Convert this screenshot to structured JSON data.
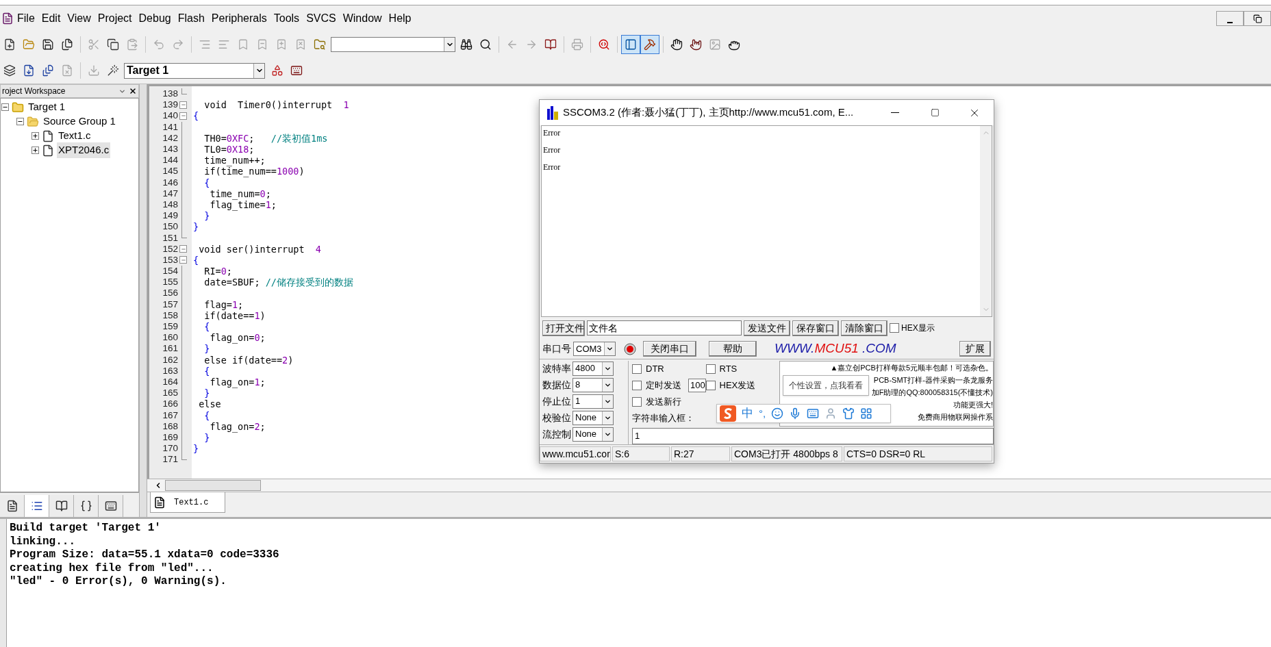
{
  "menu": [
    "File",
    "Edit",
    "View",
    "Project",
    "Debug",
    "Flash",
    "Peripherals",
    "Tools",
    "SVCS",
    "Window",
    "Help"
  ],
  "toolbar_main": [
    {
      "kind": "new",
      "disabled": false,
      "pressed": false
    },
    {
      "kind": "open",
      "disabled": false,
      "pressed": false
    },
    {
      "kind": "save",
      "disabled": false,
      "pressed": false
    },
    {
      "kind": "saveall",
      "disabled": false,
      "pressed": false
    },
    {
      "kind": "sep"
    },
    {
      "kind": "cut",
      "disabled": true,
      "pressed": false
    },
    {
      "kind": "copy",
      "disabled": false,
      "pressed": false
    },
    {
      "kind": "paste",
      "disabled": true,
      "pressed": false
    },
    {
      "kind": "sep"
    },
    {
      "kind": "undo",
      "disabled": true,
      "pressed": false
    },
    {
      "kind": "redo",
      "disabled": true,
      "pressed": false
    },
    {
      "kind": "sep"
    },
    {
      "kind": "indent",
      "disabled": true,
      "pressed": false
    },
    {
      "kind": "outdent",
      "disabled": true,
      "pressed": false
    },
    {
      "kind": "bookmark",
      "disabled": true,
      "pressed": false
    },
    {
      "kind": "bmprev",
      "disabled": true,
      "pressed": false
    },
    {
      "kind": "bmnext",
      "disabled": true,
      "pressed": false
    },
    {
      "kind": "bmclear",
      "disabled": true,
      "pressed": false
    },
    {
      "kind": "findfiles",
      "disabled": false,
      "pressed": false
    },
    {
      "kind": "combo"
    },
    {
      "kind": "find",
      "disabled": false,
      "pressed": false
    },
    {
      "kind": "incfind",
      "disabled": false,
      "pressed": false
    },
    {
      "kind": "sep"
    },
    {
      "kind": "back",
      "disabled": true,
      "pressed": false
    },
    {
      "kind": "forward",
      "disabled": true,
      "pressed": false
    },
    {
      "kind": "book",
      "disabled": false,
      "pressed": false
    },
    {
      "kind": "sep"
    },
    {
      "kind": "print",
      "disabled": true,
      "pressed": false
    },
    {
      "kind": "sep"
    },
    {
      "kind": "debug",
      "disabled": false,
      "pressed": false
    },
    {
      "kind": "sep"
    },
    {
      "kind": "workspace",
      "disabled": false,
      "pressed": true
    },
    {
      "kind": "output",
      "disabled": false,
      "pressed": true
    },
    {
      "kind": "sep"
    },
    {
      "kind": "hand",
      "disabled": false,
      "pressed": false
    },
    {
      "kind": "handoff",
      "disabled": false,
      "pressed": false
    },
    {
      "kind": "image",
      "disabled": true,
      "pressed": false
    },
    {
      "kind": "grab",
      "disabled": false,
      "pressed": false
    }
  ],
  "toolbar_build": [
    {
      "kind": "translate",
      "disabled": false
    },
    {
      "kind": "build",
      "disabled": false
    },
    {
      "kind": "rebuild",
      "disabled": false
    },
    {
      "kind": "stop",
      "disabled": true
    },
    {
      "kind": "sep"
    },
    {
      "kind": "load",
      "disabled": true
    },
    {
      "kind": "options",
      "disabled": false
    }
  ],
  "target_select": {
    "value": "Target 1"
  },
  "toolbar_build_extra": [
    {
      "kind": "components",
      "disabled": false
    },
    {
      "kind": "books",
      "disabled": false
    }
  ],
  "workspace": {
    "title": "roject Workspace",
    "tree": [
      {
        "label": "Target 1",
        "kind": "target",
        "expanded": true,
        "selected": false,
        "children": [
          {
            "label": "Source Group 1",
            "kind": "group",
            "expanded": true,
            "selected": false,
            "children": [
              {
                "label": "Text1.c",
                "kind": "file",
                "expanded": false,
                "selected": false
              },
              {
                "label": "XPT2046.c",
                "kind": "file",
                "expanded": false,
                "selected": true
              }
            ]
          }
        ]
      }
    ],
    "tabs": [
      {
        "kind": "files",
        "selected": false
      },
      {
        "kind": "regs",
        "selected": true
      },
      {
        "kind": "books",
        "selected": false
      },
      {
        "kind": "functions",
        "selected": false
      },
      {
        "kind": "templates",
        "selected": false
      }
    ]
  },
  "editor": {
    "lines": [
      {
        "n": "138",
        "kind": "end"
      },
      {
        "n": "139",
        "kind": "minus",
        "parts": [
          {
            "kind": "plain",
            "text": "  void  Timer0()interrupt  "
          },
          {
            "kind": "number",
            "text": "1"
          }
        ]
      },
      {
        "n": "140",
        "kind": "minus",
        "parts": [
          {
            "kind": "brace",
            "text": "{"
          }
        ]
      },
      {
        "n": "141",
        "kind": "line"
      },
      {
        "n": "142",
        "kind": "line",
        "parts": [
          {
            "kind": "plain",
            "text": "  TH0="
          },
          {
            "kind": "number",
            "text": "0XFC"
          },
          {
            "kind": "plain",
            "text": ";   "
          },
          {
            "kind": "comment",
            "text": "//装初值1ms"
          }
        ]
      },
      {
        "n": "143",
        "kind": "line",
        "parts": [
          {
            "kind": "plain",
            "text": "  TL0="
          },
          {
            "kind": "number",
            "text": "0X18"
          },
          {
            "kind": "plain",
            "text": ";"
          }
        ]
      },
      {
        "n": "144",
        "kind": "line",
        "parts": [
          {
            "kind": "plain",
            "text": "  time_num++;"
          }
        ]
      },
      {
        "n": "145",
        "kind": "line",
        "parts": [
          {
            "kind": "plain",
            "text": "  if(time_num=="
          },
          {
            "kind": "number",
            "text": "1000"
          },
          {
            "kind": "plain",
            "text": ")"
          }
        ]
      },
      {
        "n": "146",
        "kind": "line",
        "parts": [
          {
            "kind": "brace",
            "text": "  {"
          }
        ]
      },
      {
        "n": "147",
        "kind": "line",
        "parts": [
          {
            "kind": "plain",
            "text": "   time_num="
          },
          {
            "kind": "number",
            "text": "0"
          },
          {
            "kind": "plain",
            "text": ";"
          }
        ]
      },
      {
        "n": "148",
        "kind": "line",
        "parts": [
          {
            "kind": "plain",
            "text": "   flag_time="
          },
          {
            "kind": "number",
            "text": "1"
          },
          {
            "kind": "plain",
            "text": ";"
          }
        ]
      },
      {
        "n": "149",
        "kind": "line",
        "parts": [
          {
            "kind": "brace",
            "text": "  }"
          }
        ]
      },
      {
        "n": "150",
        "kind": "line",
        "parts": [
          {
            "kind": "brace",
            "text": "}"
          }
        ]
      },
      {
        "n": "151",
        "kind": "end"
      },
      {
        "n": "152",
        "kind": "minus",
        "parts": [
          {
            "kind": "plain",
            "text": " void ser()interrupt  "
          },
          {
            "kind": "number",
            "text": "4"
          }
        ]
      },
      {
        "n": "153",
        "kind": "minus",
        "parts": [
          {
            "kind": "brace",
            "text": "{"
          }
        ]
      },
      {
        "n": "154",
        "kind": "line",
        "parts": [
          {
            "kind": "plain",
            "text": "  RI="
          },
          {
            "kind": "number",
            "text": "0"
          },
          {
            "kind": "plain",
            "text": ";"
          }
        ]
      },
      {
        "n": "155",
        "kind": "line",
        "parts": [
          {
            "kind": "plain",
            "text": "  date=SBUF; "
          },
          {
            "kind": "comment",
            "text": "//储存接受到的数据"
          }
        ]
      },
      {
        "n": "156",
        "kind": "line"
      },
      {
        "n": "157",
        "kind": "line",
        "parts": [
          {
            "kind": "plain",
            "text": "  flag="
          },
          {
            "kind": "number",
            "text": "1"
          },
          {
            "kind": "plain",
            "text": ";"
          }
        ]
      },
      {
        "n": "158",
        "kind": "line",
        "parts": [
          {
            "kind": "plain",
            "text": "  if(date=="
          },
          {
            "kind": "number",
            "text": "1"
          },
          {
            "kind": "plain",
            "text": ")"
          }
        ]
      },
      {
        "n": "159",
        "kind": "line",
        "parts": [
          {
            "kind": "brace",
            "text": "  {"
          }
        ]
      },
      {
        "n": "160",
        "kind": "line",
        "parts": [
          {
            "kind": "plain",
            "text": "   flag_on="
          },
          {
            "kind": "number",
            "text": "0"
          },
          {
            "kind": "plain",
            "text": ";"
          }
        ]
      },
      {
        "n": "161",
        "kind": "line",
        "parts": [
          {
            "kind": "brace",
            "text": "  }"
          }
        ]
      },
      {
        "n": "162",
        "kind": "line",
        "parts": [
          {
            "kind": "plain",
            "text": "  else if(date=="
          },
          {
            "kind": "number",
            "text": "2"
          },
          {
            "kind": "plain",
            "text": ")"
          }
        ]
      },
      {
        "n": "163",
        "kind": "line",
        "parts": [
          {
            "kind": "brace",
            "text": "  {"
          }
        ]
      },
      {
        "n": "164",
        "kind": "line",
        "parts": [
          {
            "kind": "plain",
            "text": "   flag_on="
          },
          {
            "kind": "number",
            "text": "1"
          },
          {
            "kind": "plain",
            "text": ";"
          }
        ]
      },
      {
        "n": "165",
        "kind": "line",
        "parts": [
          {
            "kind": "brace",
            "text": "  }"
          }
        ]
      },
      {
        "n": "166",
        "kind": "line",
        "parts": [
          {
            "kind": "plain",
            "text": " else"
          }
        ]
      },
      {
        "n": "167",
        "kind": "line",
        "parts": [
          {
            "kind": "brace",
            "text": "  {"
          }
        ]
      },
      {
        "n": "168",
        "kind": "line",
        "parts": [
          {
            "kind": "plain",
            "text": "   flag_on="
          },
          {
            "kind": "number",
            "text": "2"
          },
          {
            "kind": "plain",
            "text": ";"
          }
        ]
      },
      {
        "n": "169",
        "kind": "line",
        "parts": [
          {
            "kind": "brace",
            "text": "  }"
          }
        ]
      },
      {
        "n": "170",
        "kind": "line",
        "parts": [
          {
            "kind": "brace",
            "text": "}"
          }
        ]
      },
      {
        "n": "171",
        "kind": "end"
      }
    ],
    "tabs": [
      {
        "label": "Text1.c",
        "selected": true
      }
    ]
  },
  "output": [
    "Build target 'Target 1'",
    "linking...",
    "Program Size: data=55.1 xdata=0 code=3336",
    "creating hex file from \"led\"...",
    "\"led\" - 0 Error(s), 0 Warning(s)."
  ],
  "sscom": {
    "title": "SSCOM3.2 (作者:聂小猛(丁丁), 主页http://www.mcu51.com,  E...",
    "received": [
      "Error",
      "Error",
      "Error"
    ],
    "open_file_button": "打开文件",
    "file_name": "文件名",
    "send_file_button": "发送文件",
    "save_button": "保存窗口",
    "clear_button": "清除窗口",
    "hex_display": {
      "label": "HEX显示",
      "checked": false
    },
    "port_label": "串口号",
    "port": "COM3",
    "port_open": true,
    "close_port_button": "关闭串口",
    "help_button": "帮助",
    "logo": [
      {
        "text": "WWW.",
        "color": "#1c1ca8"
      },
      {
        "text": "MCU51",
        "color": "#e01010"
      },
      {
        "text": " .COM",
        "color": "#1c1ca8"
      }
    ],
    "expand_button": "扩展",
    "params": [
      {
        "label": "波特率",
        "value": "4800"
      },
      {
        "label": "数据位",
        "value": "8"
      },
      {
        "label": "停止位",
        "value": "1"
      },
      {
        "label": "校验位",
        "value": "None"
      },
      {
        "label": "流控制",
        "value": "None"
      }
    ],
    "options": [
      {
        "label": "DTR",
        "checked": false
      },
      {
        "label": "RTS",
        "checked": false
      },
      {
        "label": "定时发送",
        "checked": false
      },
      {
        "label": "HEX发送",
        "checked": false
      },
      {
        "label": "发送新行",
        "checked": false
      }
    ],
    "interval": "100",
    "string_label": "字符串输入框：",
    "input_value": "1",
    "ads": [
      "▲嘉立创PCB打样每款5元顺丰包邮！可选杂色。",
      "PCB-SMT打样-器件采购一条龙服务",
      "加F助理的QQ:800058315(不懂技术)",
      "功能更强大!",
      "免费商用物联网操作系"
    ],
    "status": [
      "www.mcu51.cor",
      "S:6",
      "R:27",
      "COM3已打开  4800bps  8",
      "CTS=0 DSR=0 RL"
    ],
    "tooltip": "个性设置，点我看看",
    "ime": {
      "mode": "中",
      "punct": "°,"
    }
  }
}
